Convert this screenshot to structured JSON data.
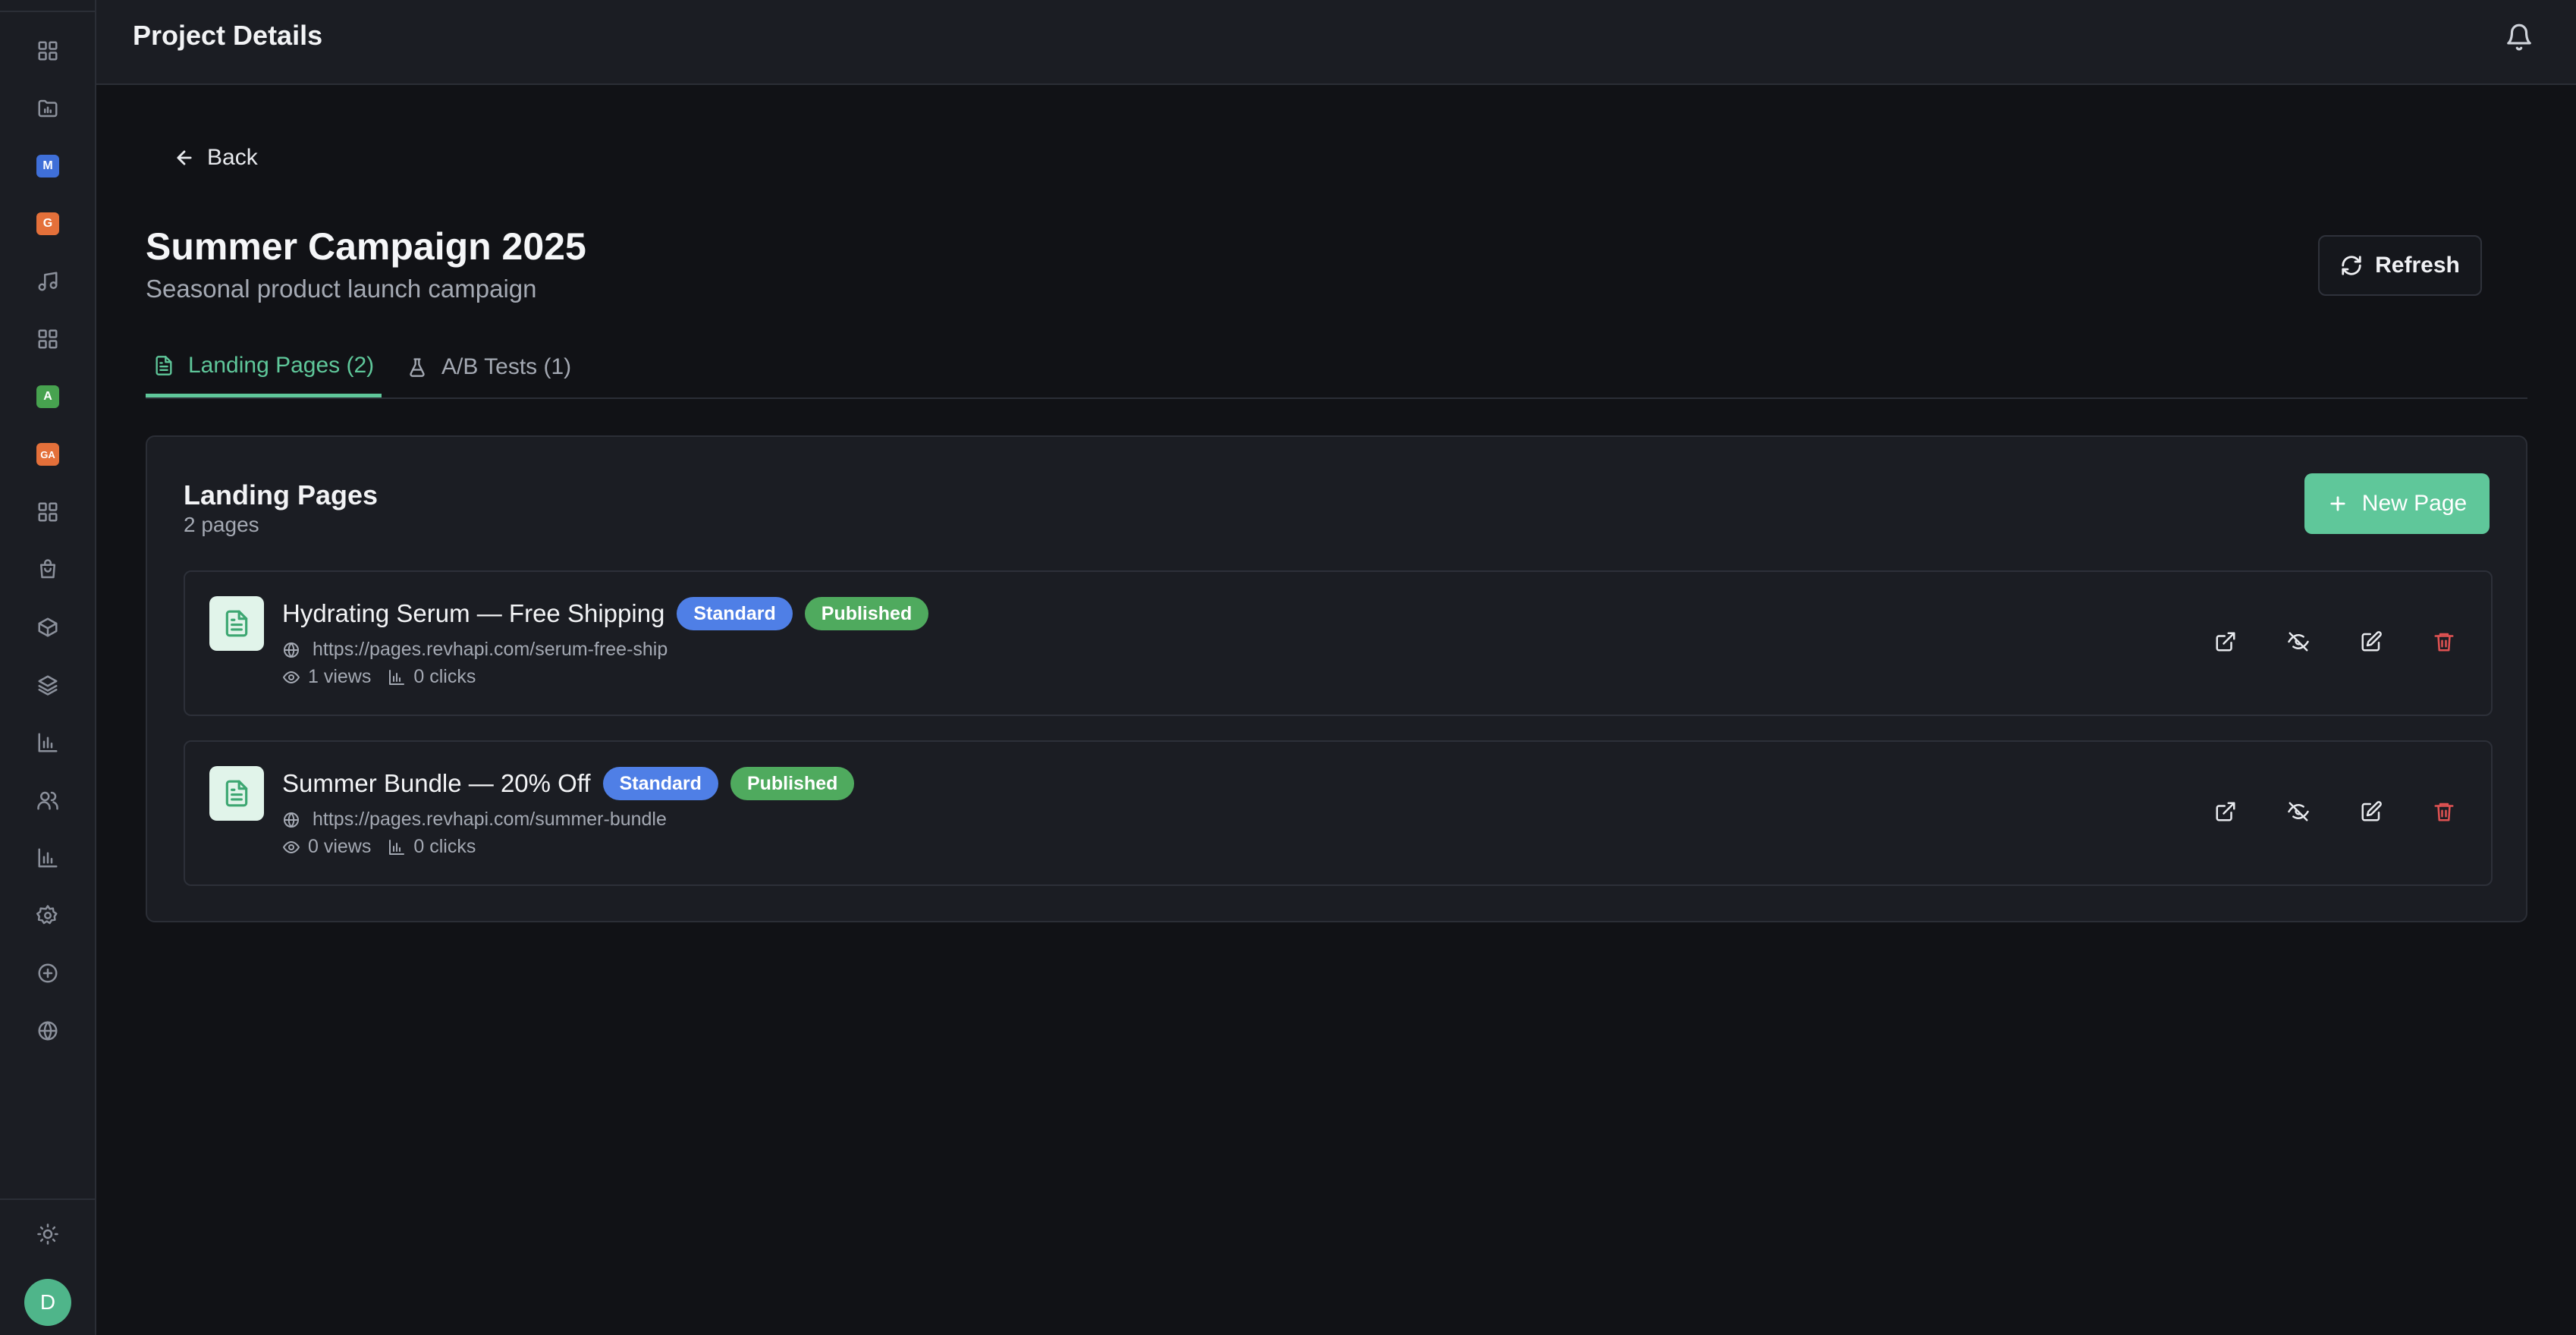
{
  "header": {
    "title": "Project Details"
  },
  "nav": {
    "back_label": "Back"
  },
  "project": {
    "title": "Summer Campaign 2025",
    "subtitle": "Seasonal product launch campaign",
    "refresh_label": "Refresh"
  },
  "sidebar": {
    "badges": [
      {
        "text": "M",
        "color": "#3f6fd8"
      },
      {
        "text": "G",
        "color": "#e4703a"
      },
      {
        "text": "A",
        "color": "#47a24f"
      },
      {
        "text": "GA",
        "color": "#e4703a"
      }
    ],
    "avatar_initial": "D"
  },
  "tabs": [
    {
      "label": "Landing Pages (2)",
      "icon": "file-text-icon",
      "active": true
    },
    {
      "label": "A/B Tests (1)",
      "icon": "flask-icon",
      "active": false
    }
  ],
  "panel": {
    "title": "Landing Pages",
    "count": "2 pages",
    "new_page_label": "New Page"
  },
  "pages": [
    {
      "title": "Hydrating Serum — Free Shipping",
      "type_badge": "Standard",
      "status_badge": "Published",
      "url": "https://pages.revhapi.com/serum-free-ship",
      "views": "1 views",
      "clicks": "0 clicks"
    },
    {
      "title": "Summer Bundle — 20% Off",
      "type_badge": "Standard",
      "status_badge": "Published",
      "url": "https://pages.revhapi.com/summer-bundle",
      "views": "0 views",
      "clicks": "0 clicks"
    }
  ],
  "colors": {
    "accent": "#5fc79a",
    "standard_badge": "#4f7fe6",
    "published_badge": "#4faa5e",
    "danger": "#e05252"
  }
}
